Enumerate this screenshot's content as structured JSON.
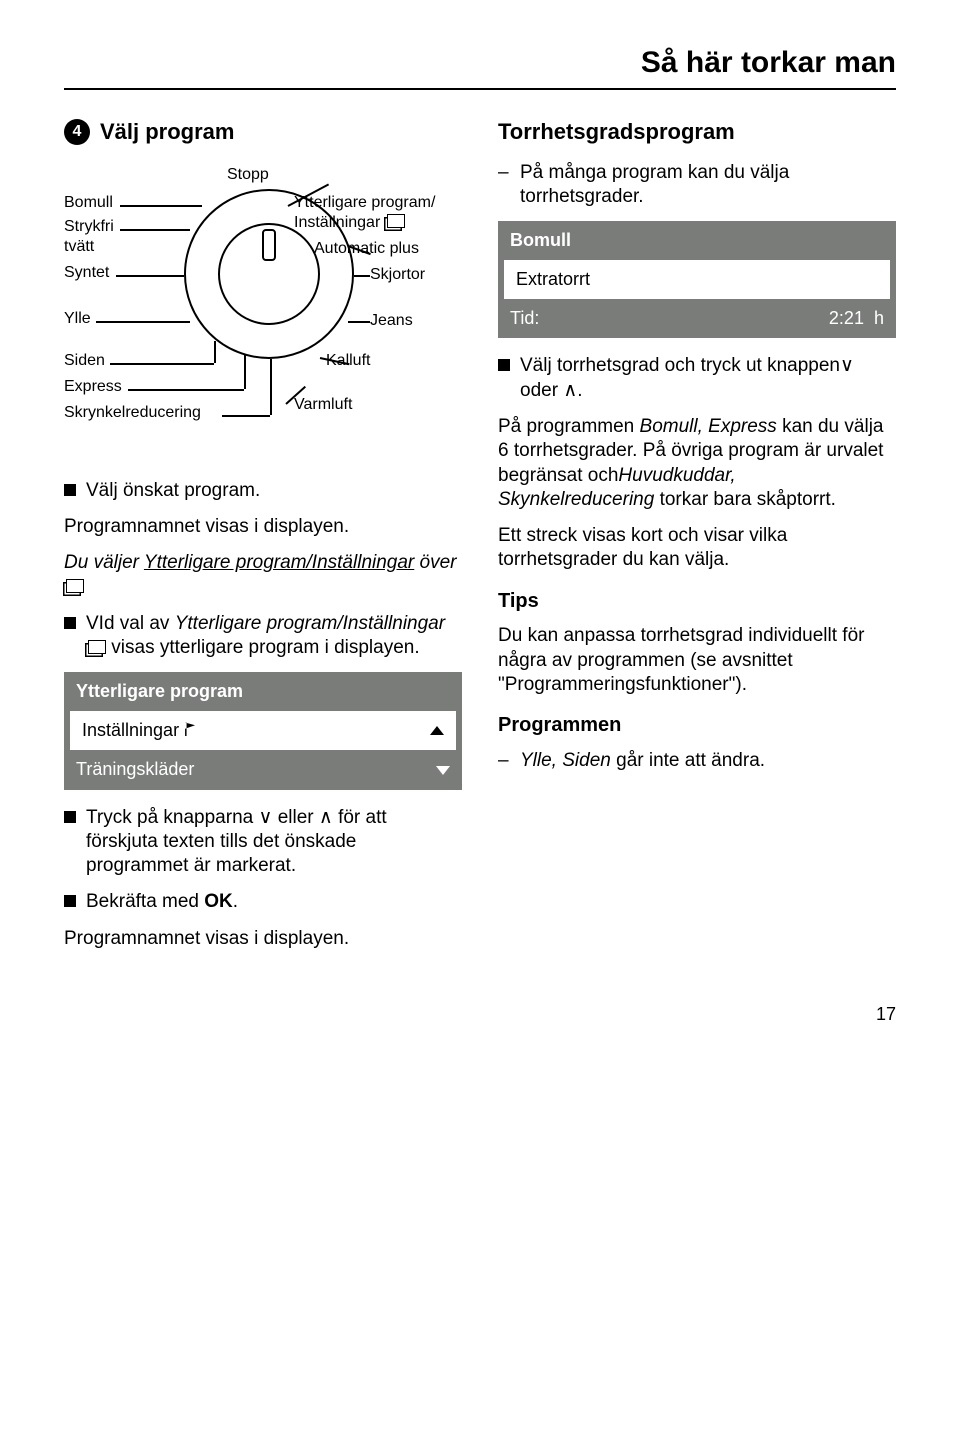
{
  "page_title": "Så här torkar man",
  "step_number": "4",
  "step_title": "Välj program",
  "dial": {
    "top": "Stopp",
    "left": [
      "Bomull",
      "Strykfri",
      "tvätt",
      "Syntet",
      "Ylle",
      "Siden",
      "Express",
      "Skrynkelreducering"
    ],
    "right": [
      "Ytterligare program/",
      "Inställningar",
      "Automatic plus",
      "Skjortor",
      "Jeans",
      "Kalluft",
      "Varmluft"
    ]
  },
  "left_body": {
    "b1": "Välj önskat program.",
    "p1": "Programnamnet visas i displayen.",
    "p2a": "Du väljer ",
    "p2b": "Ytterligare program/Inställningar",
    "p2c": " över ",
    "b2a": "VId val av ",
    "b2b": "Ytterligare program/Inställningar",
    "b2c": " visas ytterligare program i displayen.",
    "lcd1": {
      "header": "Ytterligare program",
      "selected": "Inställningar",
      "next": "Träningskläder"
    },
    "b3a": "Tryck på knapparna ",
    "b3b": " eller ",
    "b3c": " för att förskjuta texten tills det önskade programmet är markerat.",
    "b4a": "Bekräfta med ",
    "b4b": "OK",
    "b4c": ".",
    "p3": "Programnamnet visas i displayen."
  },
  "right_body": {
    "h2": "Torrhetsgradsprogram",
    "d1": "På många program kan du välja torrhetsgrader.",
    "lcd2": {
      "header": "Bomull",
      "selected": "Extratorrt",
      "footer_label": "Tid:",
      "footer_time": "2:21",
      "footer_unit": "h"
    },
    "b1a": "Välj torrhetsgrad och tryck ut knappen",
    "b1b": " oder ",
    "b1c": ".",
    "p1a": "På programmen ",
    "p1b": "Bomull, Express",
    "p1c": " kan du välja 6 torrhetsgrader. På övriga program är urvalet begränsat och",
    "p1d": "Huvudkuddar, Skynkelreducering",
    "p1e": " torkar bara skåptorrt.",
    "p2": "Ett streck visas kort och visar vilka torrhetsgrader du kan välja.",
    "h3a": "Tips",
    "p3": "Du kan anpassa torrhetsgrad individuellt för några av programmen (se avsnittet \"Programmeringsfunktioner\").",
    "h3b": "Programmen",
    "d2a": "Ylle, Siden",
    "d2b": " går inte att ändra."
  },
  "page_number": "17"
}
